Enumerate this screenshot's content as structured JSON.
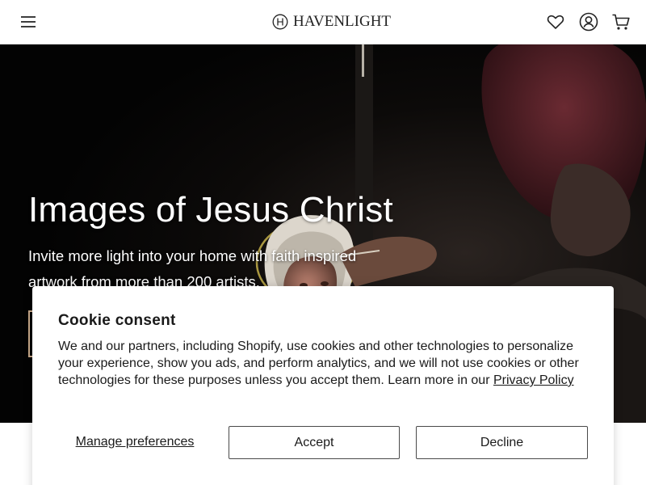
{
  "header": {
    "brand": "HAVENLIGHT",
    "icons": {
      "menu": "hamburger-menu-icon",
      "wishlist": "heart-icon",
      "account": "user-account-icon",
      "cart": "shopping-cart-icon"
    }
  },
  "hero": {
    "title": "Images of Jesus Christ",
    "subtitle": "Invite more light into your home with faith inspired artwork from more than 200 artists.",
    "cta_border_color": "#c9a98a"
  },
  "cookie": {
    "title": "Cookie consent",
    "body": "We and our partners, including Shopify, use cookies and other technologies to personalize your experience, show you ads, and perform analytics, and we will not use cookies or other technologies for these purposes unless you accept them. Learn more in our ",
    "policy_link": "Privacy Policy",
    "manage_label": "Manage preferences",
    "accept_label": "Accept",
    "decline_label": "Decline"
  }
}
